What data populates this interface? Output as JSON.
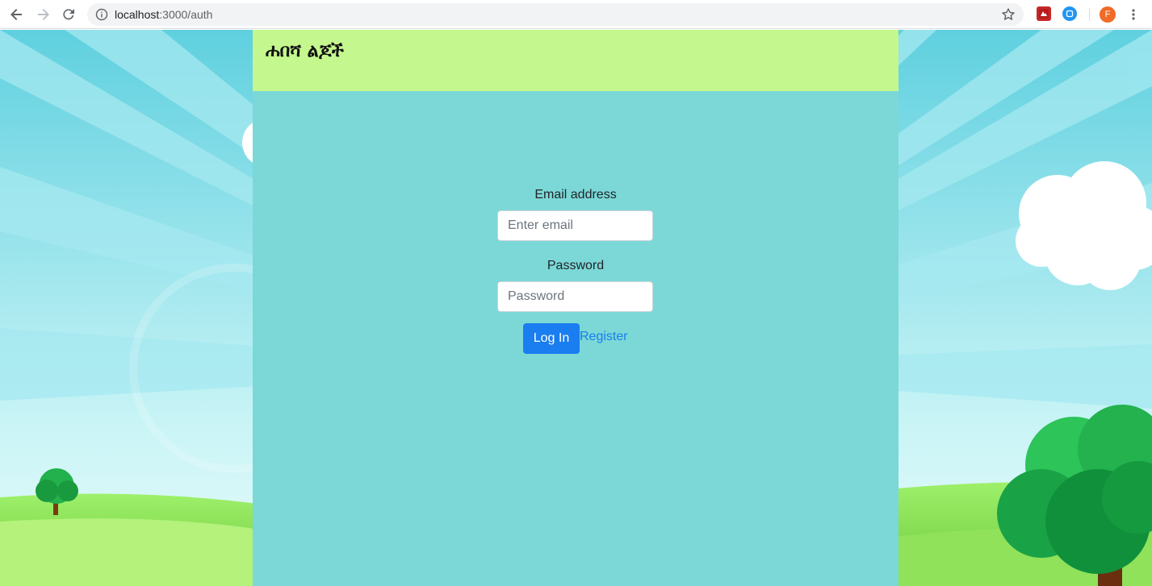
{
  "browser": {
    "url_host": "localhost",
    "url_path": ":3000/auth",
    "avatar_letter": "F"
  },
  "app": {
    "brand_title": "ሐበሻ ልጆች"
  },
  "login_form": {
    "email_label": "Email address",
    "email_placeholder": "Enter email",
    "password_label": "Password",
    "password_placeholder": "Password",
    "login_button": "Log In",
    "register_link": "Register"
  },
  "colors": {
    "header_bg": "#c4f78d",
    "panel_bg": "#7bd8d7",
    "primary": "#1a7df0",
    "avatar": "#f06b26"
  }
}
